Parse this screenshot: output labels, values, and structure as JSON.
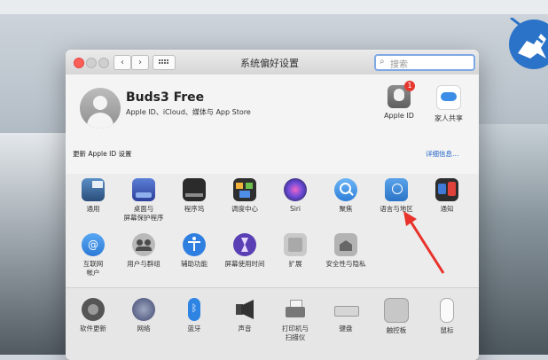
{
  "window": {
    "title": "系统偏好设置"
  },
  "toolbar": {
    "back_label": "‹",
    "forward_label": "›"
  },
  "search": {
    "placeholder": "搜索"
  },
  "account": {
    "name": "Buds3 Free",
    "subtitle": "Apple ID、iCloud、媒体与 App Store",
    "update_text": "更新 Apple ID 设置",
    "details_link": "详细信息…"
  },
  "top_icons": [
    {
      "label": "Apple ID",
      "badge": "1"
    },
    {
      "label": "家人共享"
    }
  ],
  "row1": [
    {
      "label": "通用",
      "icon": "general-icon"
    },
    {
      "label": "桌面与\n屏幕保护程序",
      "icon": "desktop-icon"
    },
    {
      "label": "程序坞",
      "icon": "dock-icon"
    },
    {
      "label": "调度中心",
      "icon": "mission-control-icon"
    },
    {
      "label": "Siri",
      "icon": "siri-icon"
    },
    {
      "label": "聚焦",
      "icon": "spotlight-icon"
    },
    {
      "label": "语言与地区",
      "icon": "language-region-icon"
    },
    {
      "label": "通知",
      "icon": "notifications-icon"
    }
  ],
  "row2": [
    {
      "label": "互联网\n帐户",
      "icon": "internet-accounts-icon"
    },
    {
      "label": "用户与群组",
      "icon": "users-groups-icon"
    },
    {
      "label": "辅助功能",
      "icon": "accessibility-icon"
    },
    {
      "label": "屏幕使用时间",
      "icon": "screen-time-icon"
    },
    {
      "label": "扩展",
      "icon": "extensions-icon"
    },
    {
      "label": "安全性与隐私",
      "icon": "security-icon"
    }
  ],
  "row3": [
    {
      "label": "软件更新",
      "icon": "software-update-icon"
    },
    {
      "label": "网络",
      "icon": "network-icon"
    },
    {
      "label": "蓝牙",
      "icon": "bluetooth-icon"
    },
    {
      "label": "声音",
      "icon": "sound-icon"
    },
    {
      "label": "打印机与\n扫描仪",
      "icon": "printer-icon"
    },
    {
      "label": "键盘",
      "icon": "keyboard-icon"
    },
    {
      "label": "触控板",
      "icon": "trackpad-icon"
    },
    {
      "label": "鼠标",
      "icon": "mouse-icon"
    }
  ],
  "colors": {
    "accent": "#2464c8",
    "arrow": "#e8322b"
  }
}
